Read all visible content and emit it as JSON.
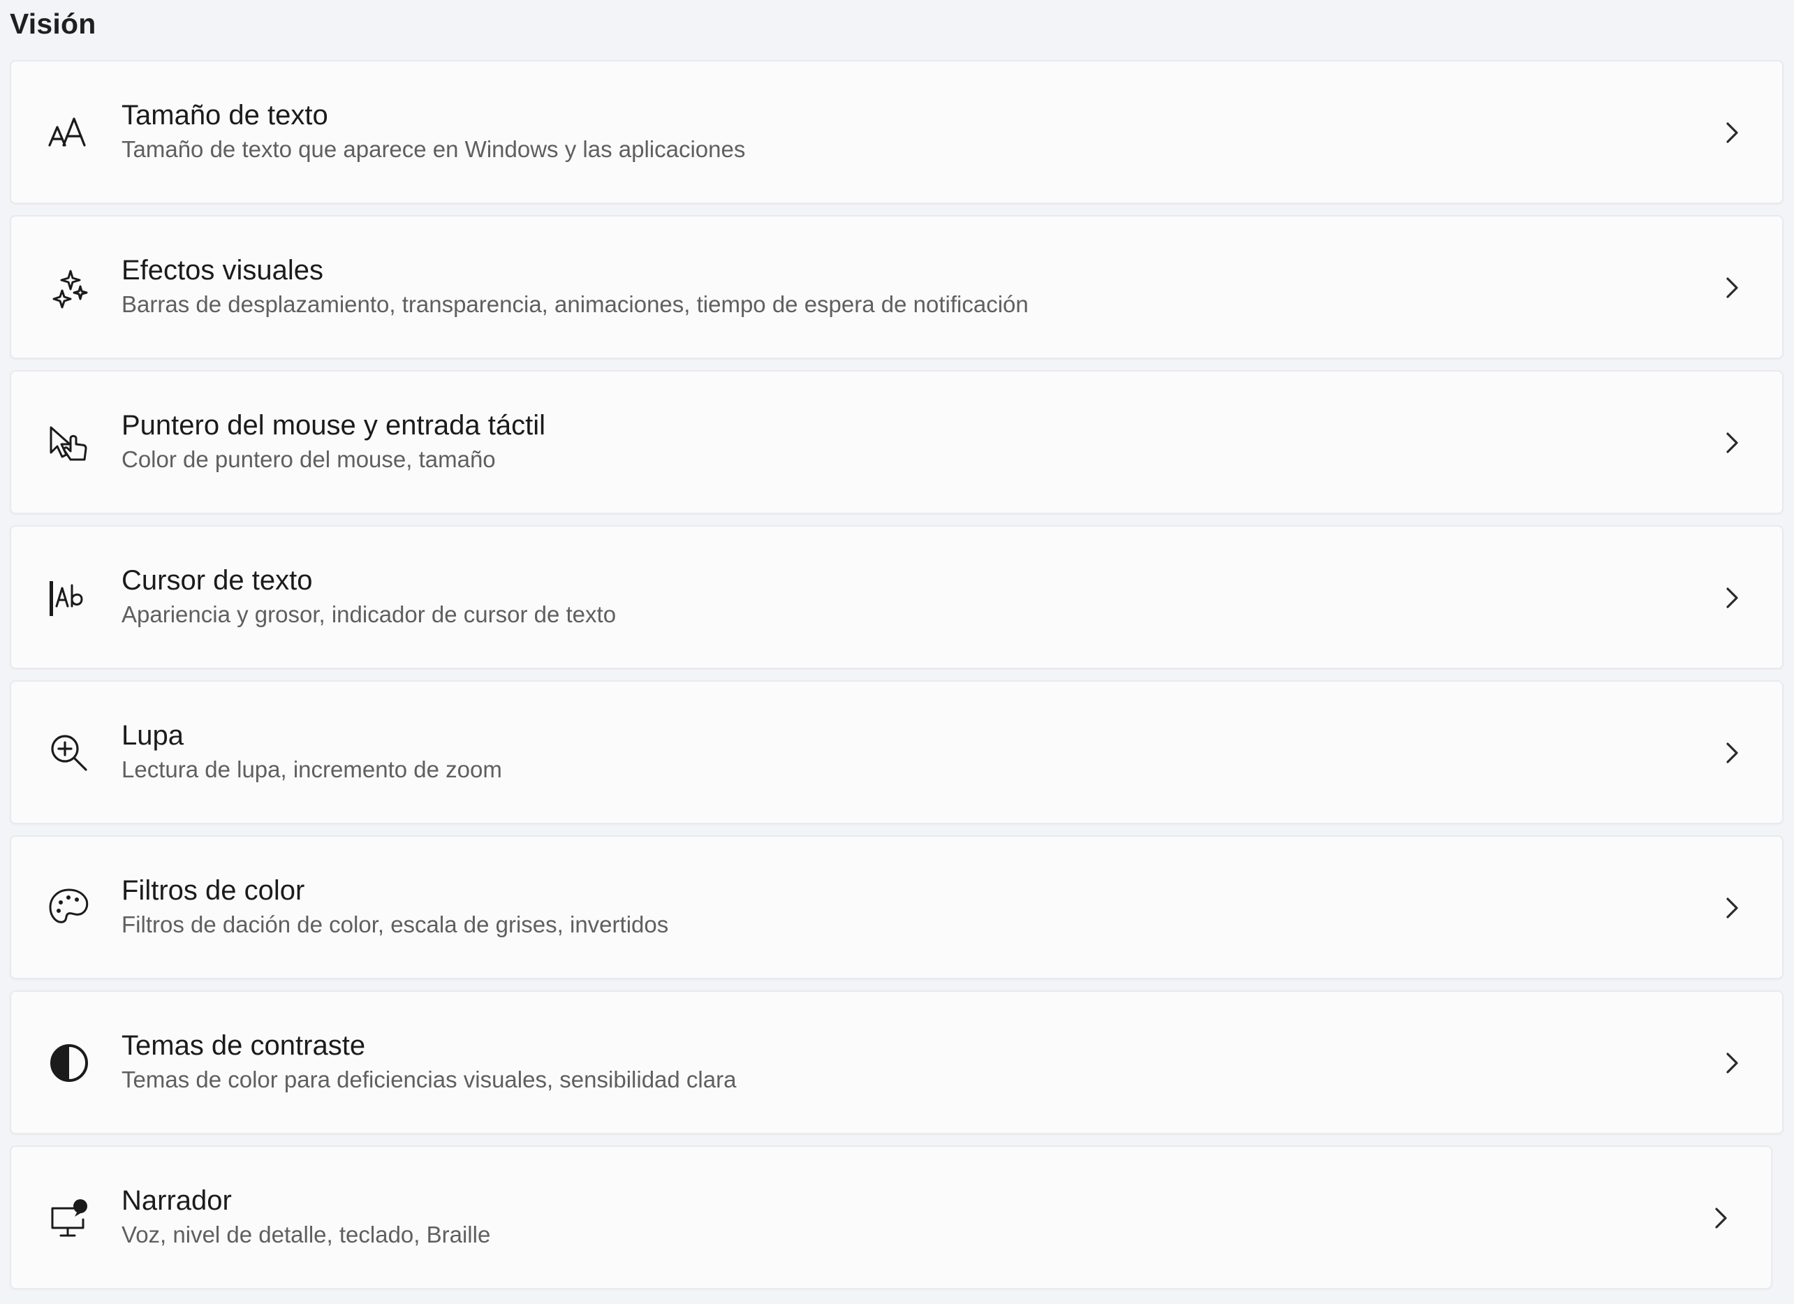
{
  "section": {
    "title": "Visión"
  },
  "items": [
    {
      "title": "Tamaño de texto",
      "description": "Tamaño de texto que aparece en Windows y las aplicaciones",
      "icon": "text-size-icon"
    },
    {
      "title": "Efectos visuales",
      "description": "Barras de desplazamiento, transparencia, animaciones, tiempo de espera de notificación",
      "icon": "sparkle-icon"
    },
    {
      "title": "Puntero del mouse y entrada táctil",
      "description": "Color de puntero del mouse, tamaño",
      "icon": "mouse-pointer-touch-icon"
    },
    {
      "title": "Cursor de texto",
      "description": "Apariencia y grosor, indicador de cursor de texto",
      "icon": "text-cursor-icon"
    },
    {
      "title": "Lupa",
      "description": "Lectura de lupa, incremento de zoom",
      "icon": "magnifier-icon"
    },
    {
      "title": "Filtros de color",
      "description": "Filtros de dación de color, escala de grises, invertidos",
      "icon": "color-palette-icon"
    },
    {
      "title": "Temas de contraste",
      "description": "Temas de color para deficiencias visuales, sensibilidad clara",
      "icon": "contrast-icon"
    },
    {
      "title": "Narrador",
      "description": "Voz, nivel de detalle, teclado, Braille",
      "icon": "narrator-icon"
    }
  ]
}
